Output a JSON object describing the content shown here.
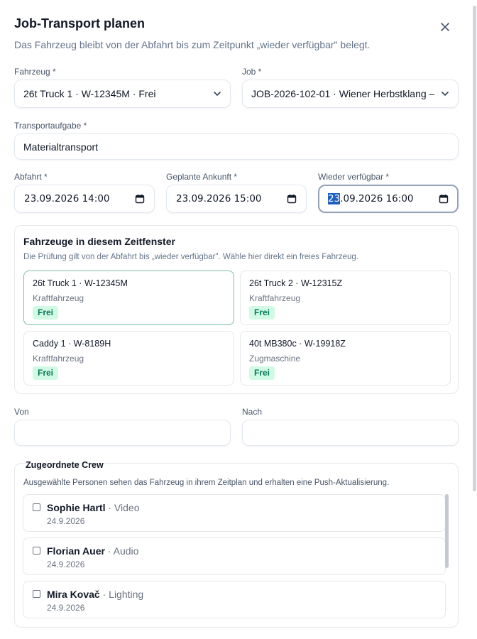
{
  "dialog": {
    "title": "Job-Transport planen",
    "subtitle": "Das Fahrzeug bleibt von der Abfahrt bis zum Zeitpunkt „wieder verfügbar\" belegt.",
    "close_icon": "close-icon"
  },
  "form": {
    "vehicle": {
      "label": "Fahrzeug *",
      "value": "26t Truck 1 · W-12345M · Frei"
    },
    "job": {
      "label": "Job *",
      "value": "JOB-2026-102-01 · Wiener Herbstklang –"
    },
    "task": {
      "label": "Transportaufgabe *",
      "value": "Materialtransport"
    },
    "departure": {
      "label": "Abfahrt *",
      "value": "23.09.2026 14:00"
    },
    "arrival": {
      "label": "Geplante Ankunft *",
      "value": "23.09.2026 15:00"
    },
    "available": {
      "label": "Wieder verfügbar *",
      "value_day": "23",
      "value_rest": ".09.2026 16:00"
    },
    "from": {
      "label": "Von",
      "value": ""
    },
    "to": {
      "label": "Nach",
      "value": ""
    }
  },
  "availability": {
    "title": "Fahrzeuge in diesem Zeitfenster",
    "description": "Die Prüfung gilt von der Abfahrt bis „wieder verfügbar\". Wähle hier direkt ein freies Fahrzeug.",
    "vehicles": [
      {
        "name": "26t Truck 1 · W-12345M",
        "type": "Kraftfahrzeug",
        "status": "Frei",
        "selected": true
      },
      {
        "name": "26t Truck 2 · W-12315Z",
        "type": "Kraftfahrzeug",
        "status": "Frei",
        "selected": false
      },
      {
        "name": "Caddy 1 · W-8189H",
        "type": "Kraftfahrzeug",
        "status": "Frei",
        "selected": false
      },
      {
        "name": "40t MB380c · W-19918Z",
        "type": "Zugmaschine",
        "status": "Frei",
        "selected": false
      }
    ]
  },
  "crew": {
    "title": "Zugeordnete Crew",
    "description": "Ausgewählte Personen sehen das Fahrzeug in ihrem Zeitplan und erhalten eine Push-Aktualisierung.",
    "members": [
      {
        "name": "Sophie Hartl",
        "role": "Video",
        "date": "24.9.2026",
        "checked": false
      },
      {
        "name": "Florian Auer",
        "role": "Audio",
        "date": "24.9.2026",
        "checked": false
      },
      {
        "name": "Mira Kovač",
        "role": "Lighting",
        "date": "24.9.2026",
        "checked": false
      }
    ]
  },
  "colors": {
    "accent_selected_border": "#7cc0a0",
    "badge_bg": "#d1fae5",
    "badge_text": "#047857",
    "focus_highlight": "#1f5fbf"
  }
}
